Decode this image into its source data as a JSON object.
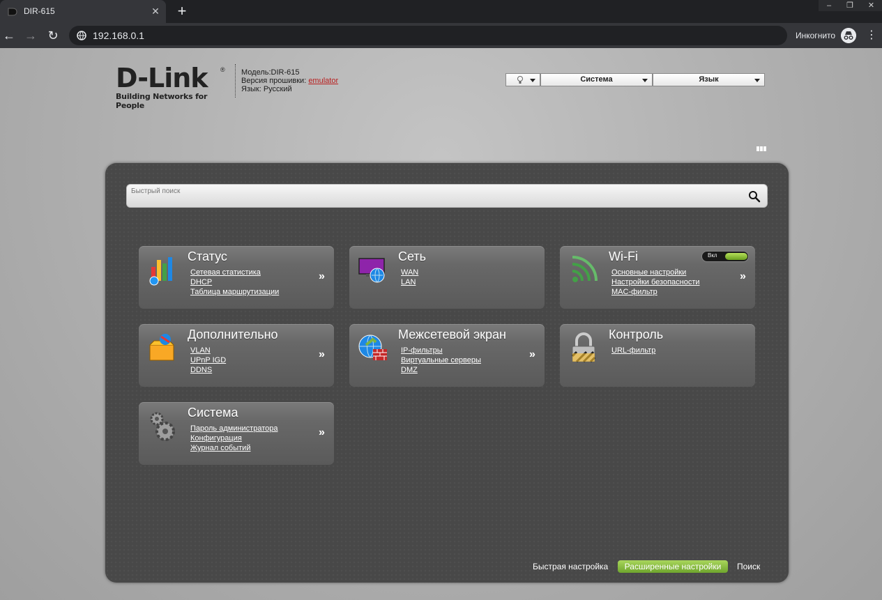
{
  "browser": {
    "tab_title": "DIR-615",
    "tab_close": "✕",
    "new_tab": "+",
    "url": "192.168.0.1",
    "incognito_label": "Инкогнито",
    "window_controls": [
      "–",
      "❐",
      "✕"
    ]
  },
  "header": {
    "logo_text": "D-Link",
    "logo_tagline": "Building Networks for People",
    "logo_reg": "®",
    "model": "Модель:DIR-615",
    "firmware_label": "Версия прошивки: ",
    "firmware_value": "emulator",
    "language_info": "Язык: Русский",
    "system_dropdown": "Система",
    "language_dropdown": "Язык"
  },
  "search": {
    "placeholder": "Быстрый поиск"
  },
  "tiles": [
    {
      "id": "status",
      "title": "Статус",
      "links": [
        "Сетевая статистика",
        "DHCP",
        "Таблица маршрутизации"
      ],
      "more": "»"
    },
    {
      "id": "network",
      "title": "Сеть",
      "links": [
        "WAN",
        "LAN"
      ],
      "more": ""
    },
    {
      "id": "wifi",
      "title": "Wi-Fi",
      "links": [
        "Основные настройки",
        "Настройки безопасности",
        "MAC-фильтр"
      ],
      "more": "»",
      "toggle_label": "Вкл"
    },
    {
      "id": "advanced",
      "title": "Дополнительно",
      "links": [
        "VLAN",
        "UPnP IGD",
        "DDNS"
      ],
      "more": "»"
    },
    {
      "id": "firewall",
      "title": "Межсетевой экран",
      "links": [
        "IP-фильтры",
        "Виртуальные серверы",
        "DMZ"
      ],
      "more": "»"
    },
    {
      "id": "control",
      "title": "Контроль",
      "links": [
        "URL-фильтр"
      ],
      "more": ""
    },
    {
      "id": "system",
      "title": "Система",
      "links": [
        "Пароль администратора",
        "Конфигурация",
        "Журнал событий"
      ],
      "more": "»"
    }
  ],
  "footer": {
    "quick_setup": "Быстрая настройка",
    "advanced_settings": "Расширенные настройки",
    "search": "Поиск"
  },
  "colors": {
    "accent_green": "#7fb536",
    "firmware_link": "#b81e1e",
    "panel_bg": "#484848"
  }
}
